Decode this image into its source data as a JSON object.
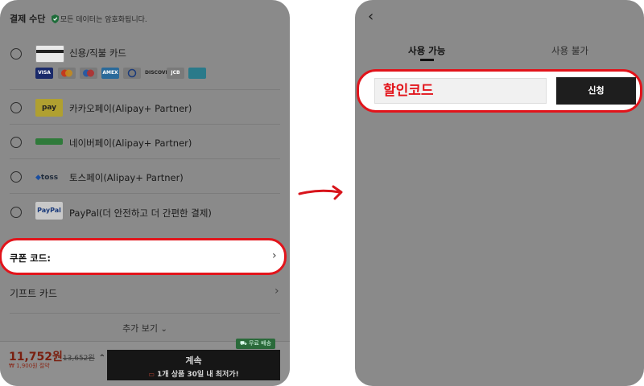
{
  "left_panel": {
    "header": {
      "title": "결제 수단",
      "secure_note": "모든 데이터는 암호화됩니다."
    },
    "methods": [
      {
        "label": "신용/직불 카드",
        "logo": "card-icon"
      },
      {
        "label": "카카오페이(Alipay+ Partner)",
        "logo": "kakaopay-logo",
        "logo_text": "pay"
      },
      {
        "label": "네이버페이(Alipay+ Partner)",
        "logo": "naverpay-logo",
        "logo_text": ""
      },
      {
        "label": "토스페이(Alipay+ Partner)",
        "logo": "tosspay-logo",
        "logo_text": "toss"
      },
      {
        "label": "PayPal(더 안전하고 더 간편한 결제)",
        "logo": "paypal-logo",
        "logo_text": "PayPal"
      }
    ],
    "card_brands": [
      "VISA",
      "",
      "",
      "AMEX",
      "",
      "DISCOVER",
      "JCB",
      ""
    ],
    "coupon_label": "쿠폰 코드:",
    "gift_card_label": "기프트 카드",
    "see_more_label": "추가 보기",
    "bottom_bar": {
      "price": "11,752원",
      "original_price": "13,652원",
      "price_note": "₩ 1,900원 절약",
      "free_shipping": "무료 배송",
      "continue_label": "계속",
      "continue_note": "1개 상품 30일 내 최저가!"
    }
  },
  "right_panel": {
    "tabs": [
      {
        "label": "사용 가능",
        "active": true
      },
      {
        "label": "사용 불가",
        "active": false
      }
    ],
    "coupon_input_value": "할인코드",
    "apply_label": "신청"
  },
  "colors": {
    "highlight": "#e2141b",
    "overlay": "#8a8a8a",
    "button": "#1e1e1e"
  }
}
